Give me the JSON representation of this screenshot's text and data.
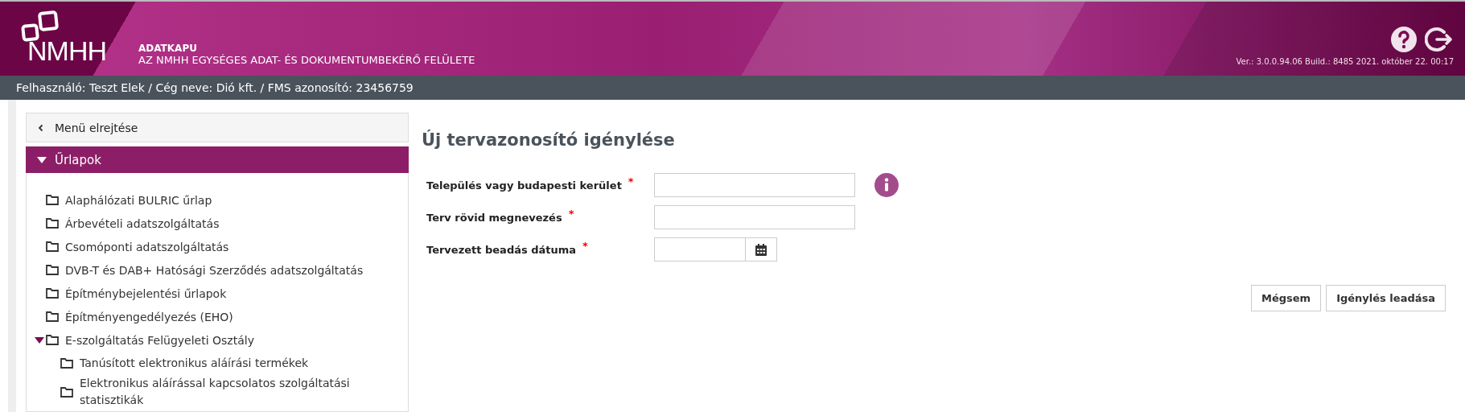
{
  "header": {
    "app_name": "ADATKAPU",
    "subtitle": "AZ NMHH EGYSÉGES ADAT- ÉS DOKUMENTUMBEKÉRŐ FELÜLETE",
    "logo_text": "NMHH",
    "version": "Ver.: 3.0.0.94.06  Build.: 8485  2021. október 22. 00:17"
  },
  "user_bar": "Felhasználó: Teszt Elek / Cég neve: Dió kft. / FMS azonosító: 23456759",
  "sidebar": {
    "hide_menu": "Menü elrejtése",
    "section": {
      "label": "Űrlapok",
      "expanded": true
    },
    "items": [
      {
        "label": "Alaphálózati BULRIC űrlap"
      },
      {
        "label": "Árbevételi adatszolgáltatás"
      },
      {
        "label": "Csomóponti adatszolgáltatás"
      },
      {
        "label": "DVB-T és DAB+ Hatósági Szerződés adatszolgáltatás"
      },
      {
        "label": "Építménybejelentési űrlapok"
      },
      {
        "label": "Építményengedélyezés (EHO)"
      },
      {
        "label": "E-szolgáltatás Felügyeleti Osztály",
        "expanded": true,
        "children": [
          {
            "label": "Tanúsított elektronikus aláírási termékek"
          },
          {
            "label": "Elektronikus aláírással kapcsolatos szolgáltatási statisztikák"
          }
        ]
      }
    ]
  },
  "form": {
    "title": "Új tervazonosító igénylése",
    "fields": [
      {
        "kind": "text",
        "label": "Település vagy budapesti kerület",
        "required": "*",
        "info": true
      },
      {
        "kind": "text",
        "label": "Terv rövid megnevezés",
        "required": "*",
        "info": false
      },
      {
        "kind": "date",
        "label": "Tervezett beadás dátuma",
        "required": "*",
        "info": false
      }
    ],
    "buttons": [
      "Mégsem",
      "Igénylés leadása"
    ]
  }
}
